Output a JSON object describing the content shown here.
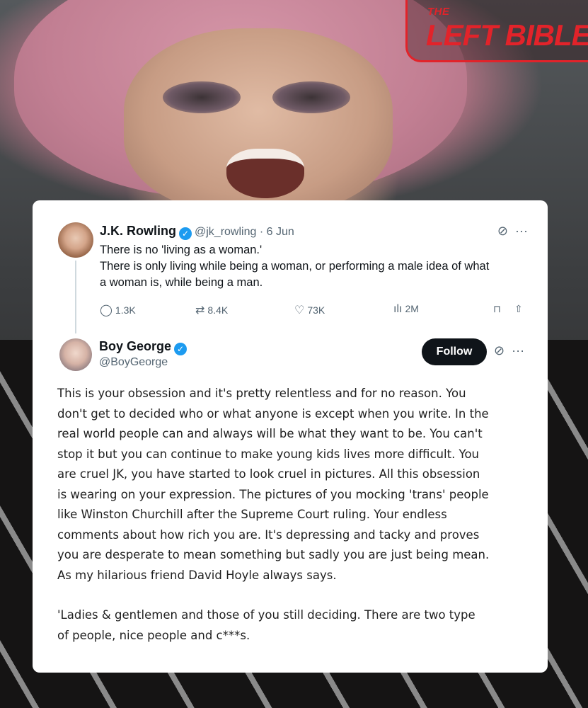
{
  "logo": {
    "top": "THE",
    "main": "LEFT BIBLE",
    "color": "#e2232a"
  },
  "tweet1": {
    "author_name": "J.K. Rowling",
    "handle_and_date": "@jk_rowling · 6 Jun",
    "avatar_icon": "profile-photo",
    "lines": [
      "There is no 'living as a woman.'",
      "There is only living while being a woman, or performing a male idea of what",
      "a woman is, while being a man."
    ],
    "stats": {
      "replies": "1.3K",
      "reposts": "8.4K",
      "likes": "73K",
      "views": "2M"
    },
    "icons": [
      "grok-icon",
      "more-icon",
      "reply-icon",
      "repost-icon",
      "like-icon",
      "views-icon",
      "bookmark-icon",
      "share-icon"
    ]
  },
  "tweet2": {
    "author_name": "Boy George",
    "handle": "@BoyGeorge",
    "follow_label": "Follow",
    "lines": [
      "This is your obsession and it's pretty relentless and for no reason. You",
      "don't get to decided who or what anyone is except when you write. In the",
      "real world people can and always will be what they want to be. You can't",
      "stop it but you can continue to make young kids lives more difficult. You",
      "are cruel JK, you have started to look cruel in pictures. All this obsession",
      "is wearing on your expression. The pictures of you mocking 'trans' people",
      "like Winston Churchill after the Supreme Court ruling. Your endless",
      "comments about how rich you are. It's depressing and tacky and proves",
      "you are desperate to mean something but sadly you are just being mean.",
      "As my hilarious friend David Hoyle always says."
    ],
    "lines2": [
      "'Ladies & gentlemen and those of you still deciding. There are two type",
      "of people, nice people and c***s."
    ]
  },
  "colors": {
    "verified": "#1d9bf0",
    "text": "#0f1419",
    "muted": "#536471"
  }
}
